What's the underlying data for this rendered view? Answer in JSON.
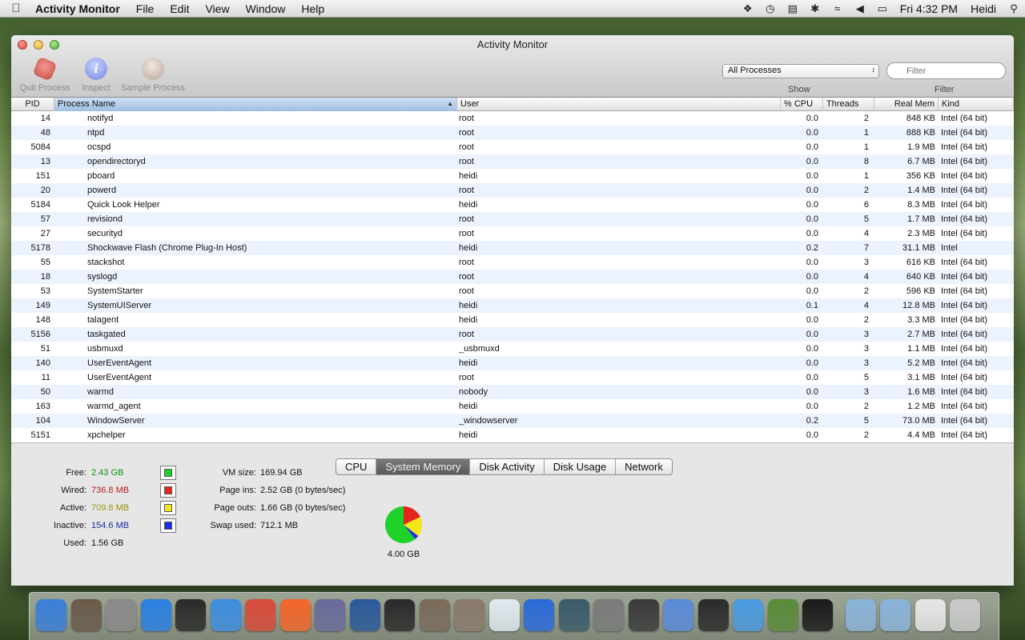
{
  "menubar": {
    "app_name": "Activity Monitor",
    "menus": [
      "File",
      "Edit",
      "View",
      "Window",
      "Help"
    ],
    "clock": "Fri 4:32 PM",
    "user": "Heidi"
  },
  "window": {
    "title": "Activity Monitor",
    "toolbar": {
      "quit_label": "Quit Process",
      "inspect_label": "Inspect",
      "sample_label": "Sample Process",
      "show_label": "Show",
      "filter_label": "Filter",
      "process_filter_selected": "All Processes",
      "filter_placeholder": "Filter"
    }
  },
  "table": {
    "columns": {
      "pid": "PID",
      "name": "Process Name",
      "user": "User",
      "cpu": "% CPU",
      "threads": "Threads",
      "mem": "Real Mem",
      "kind": "Kind"
    },
    "rows": [
      {
        "pid": "14",
        "name": "notifyd",
        "user": "root",
        "cpu": "0.0",
        "threads": "2",
        "mem": "848 KB",
        "kind": "Intel (64 bit)"
      },
      {
        "pid": "48",
        "name": "ntpd",
        "user": "root",
        "cpu": "0.0",
        "threads": "1",
        "mem": "888 KB",
        "kind": "Intel (64 bit)"
      },
      {
        "pid": "5084",
        "name": "ocspd",
        "user": "root",
        "cpu": "0.0",
        "threads": "1",
        "mem": "1.9 MB",
        "kind": "Intel (64 bit)"
      },
      {
        "pid": "13",
        "name": "opendirectoryd",
        "user": "root",
        "cpu": "0.0",
        "threads": "8",
        "mem": "6.7 MB",
        "kind": "Intel (64 bit)"
      },
      {
        "pid": "151",
        "name": "pboard",
        "user": "heidi",
        "cpu": "0.0",
        "threads": "1",
        "mem": "356 KB",
        "kind": "Intel (64 bit)"
      },
      {
        "pid": "20",
        "name": "powerd",
        "user": "root",
        "cpu": "0.0",
        "threads": "2",
        "mem": "1.4 MB",
        "kind": "Intel (64 bit)"
      },
      {
        "pid": "5184",
        "name": "Quick Look Helper",
        "user": "heidi",
        "cpu": "0.0",
        "threads": "6",
        "mem": "8.3 MB",
        "kind": "Intel (64 bit)"
      },
      {
        "pid": "57",
        "name": "revisiond",
        "user": "root",
        "cpu": "0.0",
        "threads": "5",
        "mem": "1.7 MB",
        "kind": "Intel (64 bit)"
      },
      {
        "pid": "27",
        "name": "securityd",
        "user": "root",
        "cpu": "0.0",
        "threads": "4",
        "mem": "2.3 MB",
        "kind": "Intel (64 bit)"
      },
      {
        "pid": "5178",
        "name": "Shockwave Flash (Chrome Plug-In Host)",
        "user": "heidi",
        "cpu": "0.2",
        "threads": "7",
        "mem": "31.1 MB",
        "kind": "Intel"
      },
      {
        "pid": "55",
        "name": "stackshot",
        "user": "root",
        "cpu": "0.0",
        "threads": "3",
        "mem": "616 KB",
        "kind": "Intel (64 bit)"
      },
      {
        "pid": "18",
        "name": "syslogd",
        "user": "root",
        "cpu": "0.0",
        "threads": "4",
        "mem": "640 KB",
        "kind": "Intel (64 bit)"
      },
      {
        "pid": "53",
        "name": "SystemStarter",
        "user": "root",
        "cpu": "0.0",
        "threads": "2",
        "mem": "596 KB",
        "kind": "Intel (64 bit)"
      },
      {
        "pid": "149",
        "name": "SystemUIServer",
        "user": "heidi",
        "cpu": "0.1",
        "threads": "4",
        "mem": "12.8 MB",
        "kind": "Intel (64 bit)"
      },
      {
        "pid": "148",
        "name": "talagent",
        "user": "heidi",
        "cpu": "0.0",
        "threads": "2",
        "mem": "3.3 MB",
        "kind": "Intel (64 bit)"
      },
      {
        "pid": "5156",
        "name": "taskgated",
        "user": "root",
        "cpu": "0.0",
        "threads": "3",
        "mem": "2.7 MB",
        "kind": "Intel (64 bit)"
      },
      {
        "pid": "51",
        "name": "usbmuxd",
        "user": "_usbmuxd",
        "cpu": "0.0",
        "threads": "3",
        "mem": "1.1 MB",
        "kind": "Intel (64 bit)"
      },
      {
        "pid": "140",
        "name": "UserEventAgent",
        "user": "heidi",
        "cpu": "0.0",
        "threads": "3",
        "mem": "5.2 MB",
        "kind": "Intel (64 bit)"
      },
      {
        "pid": "11",
        "name": "UserEventAgent",
        "user": "root",
        "cpu": "0.0",
        "threads": "5",
        "mem": "3.1 MB",
        "kind": "Intel (64 bit)"
      },
      {
        "pid": "50",
        "name": "warmd",
        "user": "nobody",
        "cpu": "0.0",
        "threads": "3",
        "mem": "1.6 MB",
        "kind": "Intel (64 bit)"
      },
      {
        "pid": "163",
        "name": "warmd_agent",
        "user": "heidi",
        "cpu": "0.0",
        "threads": "2",
        "mem": "1.2 MB",
        "kind": "Intel (64 bit)"
      },
      {
        "pid": "104",
        "name": "WindowServer",
        "user": "_windowserver",
        "cpu": "0.2",
        "threads": "5",
        "mem": "73.0 MB",
        "kind": "Intel (64 bit)"
      },
      {
        "pid": "5151",
        "name": "xpchelper",
        "user": "heidi",
        "cpu": "0.0",
        "threads": "2",
        "mem": "4.4 MB",
        "kind": "Intel (64 bit)"
      }
    ]
  },
  "bottom": {
    "tabs": [
      "CPU",
      "System Memory",
      "Disk Activity",
      "Disk Usage",
      "Network"
    ],
    "active_tab": "System Memory",
    "memory": [
      {
        "label": "Free:",
        "value": "2.43 GB",
        "color": "#1fd12b",
        "text_color": "#1a8a1a"
      },
      {
        "label": "Wired:",
        "value": "736.8 MB",
        "color": "#e3251c",
        "text_color": "#b01e1e"
      },
      {
        "label": "Active:",
        "value": "709.8 MB",
        "color": "#f5e61a",
        "text_color": "#9a9016"
      },
      {
        "label": "Inactive:",
        "value": "154.6 MB",
        "color": "#1a2ee8",
        "text_color": "#1a2aa0"
      }
    ],
    "used": {
      "label": "Used:",
      "value": "1.56 GB"
    },
    "vm": [
      {
        "label": "VM size:",
        "value": "169.94 GB"
      },
      {
        "label": "Page ins:",
        "value": "2.52 GB (0 bytes/sec)"
      },
      {
        "label": "Page outs:",
        "value": "1.66 GB (0 bytes/sec)"
      },
      {
        "label": "Swap used:",
        "value": "712.1 MB"
      }
    ],
    "total": "4.00 GB",
    "pie_values_mb": [
      2488,
      736.8,
      709.8,
      154.6
    ]
  },
  "dock": {
    "apps": [
      {
        "name": "finder",
        "color": "#3a7fd9"
      },
      {
        "name": "system-info",
        "color": "#6a5a4a"
      },
      {
        "name": "launchpad",
        "color": "#8a8a8a"
      },
      {
        "name": "app-store",
        "color": "#2a7fe0"
      },
      {
        "name": "dashboard",
        "color": "#2a2a2a"
      },
      {
        "name": "safari",
        "color": "#3d8ee0"
      },
      {
        "name": "chrome",
        "color": "#d84a3a"
      },
      {
        "name": "soundcloud",
        "color": "#f2662a"
      },
      {
        "name": "script-editor",
        "color": "#6a6a9a"
      },
      {
        "name": "preview",
        "color": "#2a5a9a"
      },
      {
        "name": "scrivener",
        "color": "#2a2a2a"
      },
      {
        "name": "photo-booth",
        "color": "#7a6a5a"
      },
      {
        "name": "image-capture",
        "color": "#8a7a6a"
      },
      {
        "name": "fox-app",
        "color": "#dfe9ef"
      },
      {
        "name": "itunes",
        "color": "#2a6ad9"
      },
      {
        "name": "time-machine",
        "color": "#3a5a6a"
      },
      {
        "name": "system-preferences",
        "color": "#7a7a7a"
      },
      {
        "name": "final-cut",
        "color": "#3a3a3a"
      },
      {
        "name": "mail-bird",
        "color": "#5a8ad9"
      },
      {
        "name": "circle-app",
        "color": "#2a2a2a"
      },
      {
        "name": "icloud",
        "color": "#4a9ae0"
      },
      {
        "name": "evernote",
        "color": "#5a8a3a"
      },
      {
        "name": "activity-monitor",
        "color": "#1a1a1a"
      },
      {
        "name": "documents-folder",
        "color": "#8ab3d9"
      },
      {
        "name": "applications-folder",
        "color": "#8ab3d9"
      },
      {
        "name": "downloads-stack",
        "color": "#e6e6e6"
      },
      {
        "name": "trash",
        "color": "#c9c9c9"
      }
    ]
  }
}
